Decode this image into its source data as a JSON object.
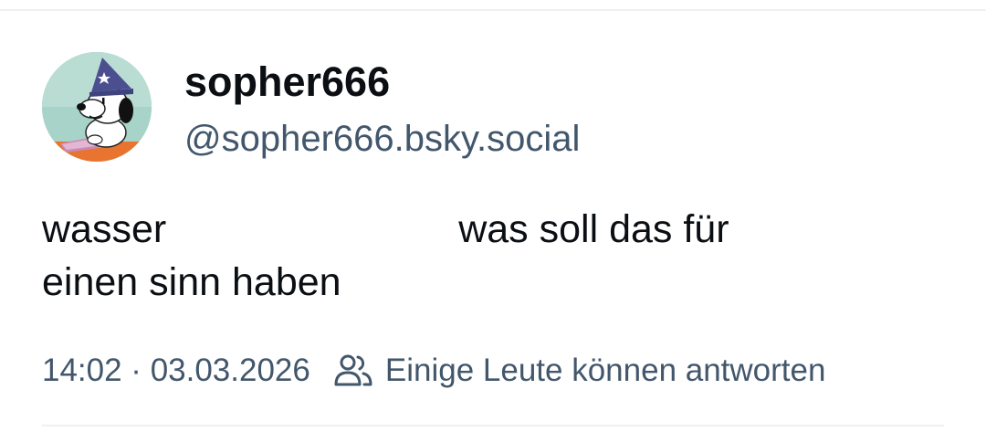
{
  "post": {
    "author": {
      "display_name": "sopher666",
      "handle": "@sopher666.bsky.social",
      "avatar_icon": "snoopy-wizard-avatar"
    },
    "text": {
      "line1_start": "wasser",
      "line1_end": "was soll das für",
      "line2": "einen sinn haben"
    },
    "meta": {
      "timestamp": "14:02 · 03.03.2026",
      "reply_setting": "Einige Leute können antworten",
      "reply_icon": "people-icon"
    }
  },
  "colors": {
    "text_primary": "#0b0f14",
    "text_secondary": "#42576c",
    "divider": "#eef0f3",
    "background": "#ffffff"
  }
}
